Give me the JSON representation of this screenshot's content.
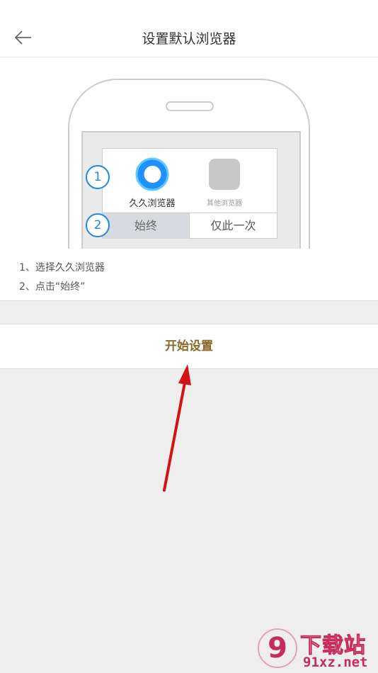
{
  "header": {
    "title": "设置默认浏览器",
    "back_icon": "back-arrow-icon"
  },
  "guide": {
    "apps": {
      "main_label": "久久浏览器",
      "other_label": "其他浏览器"
    },
    "choices": {
      "always": "始终",
      "once": "仅此一次"
    },
    "steps": {
      "badge1": "1",
      "badge2": "2"
    },
    "instructions": {
      "step1": "1、选择久久浏览器",
      "step2": "2、点击“始终”"
    }
  },
  "action": {
    "start_label": "开始设置"
  },
  "watermark": {
    "logo_text": "9",
    "name": "下载站",
    "site": "91xz.net"
  },
  "colors": {
    "accent_blue": "#1e88e5",
    "button_text": "#8b6a2b",
    "arrow_red": "#d21414",
    "watermark": "#c92b5a"
  }
}
